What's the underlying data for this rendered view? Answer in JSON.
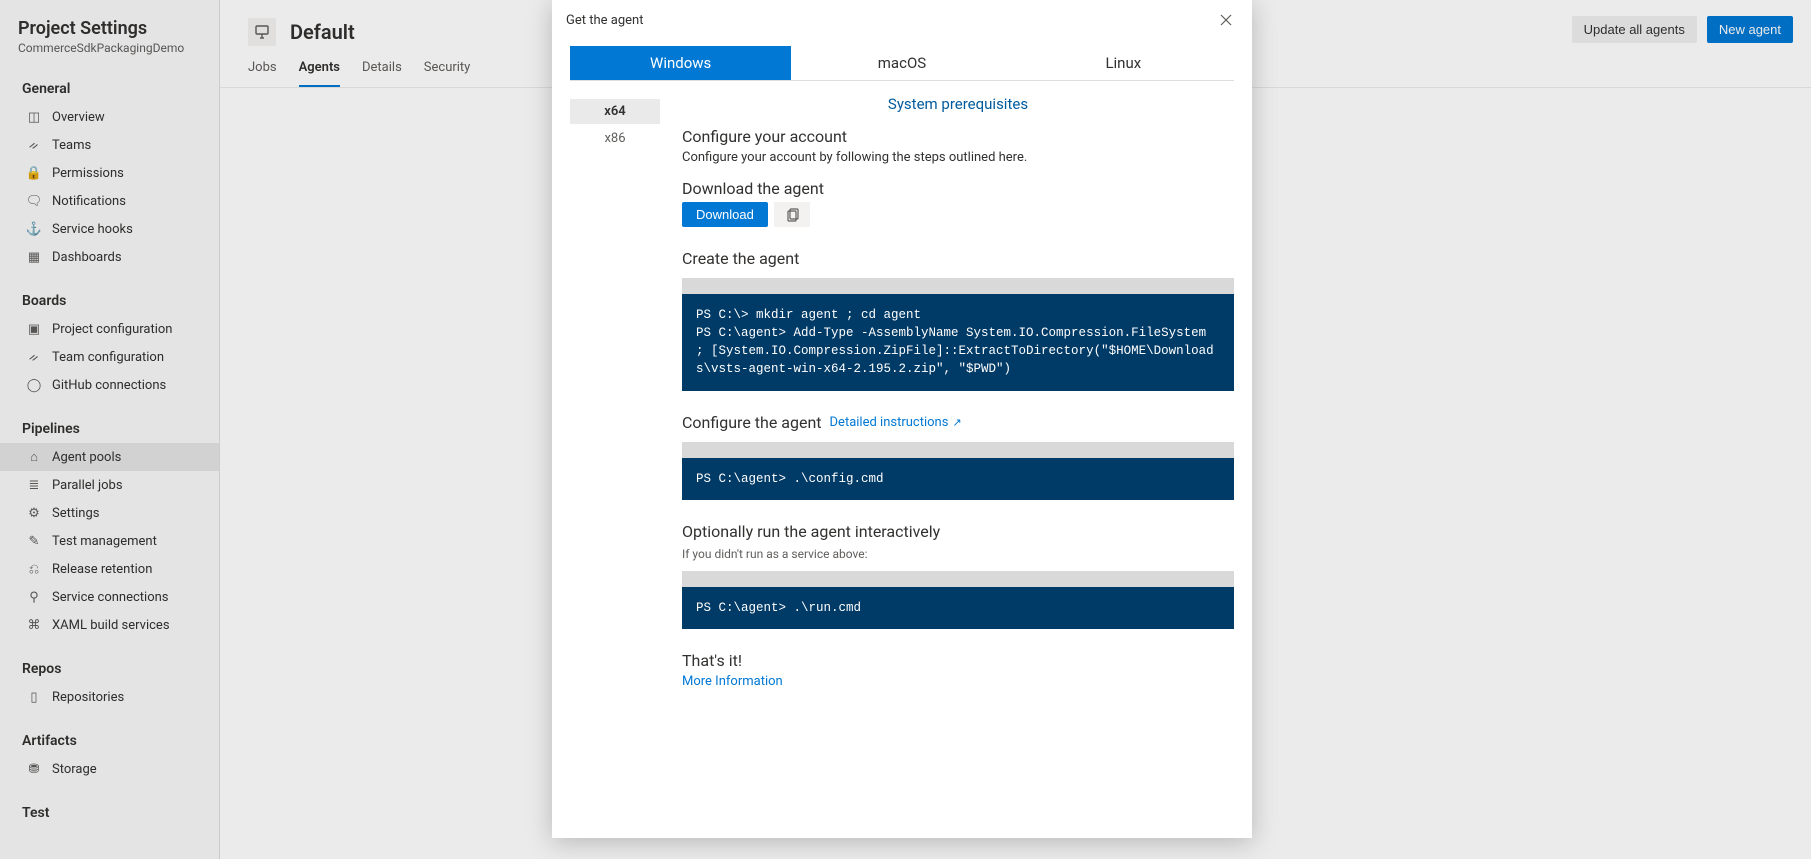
{
  "sidebar": {
    "title": "Project Settings",
    "subtitle": "CommerceSdkPackagingDemo",
    "groups": [
      {
        "label": "General",
        "items": [
          {
            "icon": "◫",
            "label": "Overview"
          },
          {
            "icon": "ᨀ",
            "label": "Teams"
          },
          {
            "icon": "🔒",
            "label": "Permissions"
          },
          {
            "icon": "🗨",
            "label": "Notifications"
          },
          {
            "icon": "⚓",
            "label": "Service hooks"
          },
          {
            "icon": "▦",
            "label": "Dashboards"
          }
        ]
      },
      {
        "label": "Boards",
        "items": [
          {
            "icon": "▣",
            "label": "Project configuration"
          },
          {
            "icon": "ᨀ",
            "label": "Team configuration"
          },
          {
            "icon": "◯",
            "label": "GitHub connections"
          }
        ]
      },
      {
        "label": "Pipelines",
        "items": [
          {
            "icon": "⌂",
            "label": "Agent pools",
            "selected": true
          },
          {
            "icon": "≣",
            "label": "Parallel jobs"
          },
          {
            "icon": "⚙",
            "label": "Settings"
          },
          {
            "icon": "✎",
            "label": "Test management"
          },
          {
            "icon": "⎌",
            "label": "Release retention"
          },
          {
            "icon": "⚲",
            "label": "Service connections"
          },
          {
            "icon": "⌘",
            "label": "XAML build services"
          }
        ]
      },
      {
        "label": "Repos",
        "items": [
          {
            "icon": "▯",
            "label": "Repositories"
          }
        ]
      },
      {
        "label": "Artifacts",
        "items": [
          {
            "icon": "⛃",
            "label": "Storage"
          }
        ]
      },
      {
        "label": "Test",
        "items": []
      }
    ]
  },
  "pool": {
    "name": "Default",
    "tabs": [
      "Jobs",
      "Agents",
      "Details",
      "Security"
    ],
    "active_tab": "Agents",
    "update_btn": "Update all agents",
    "new_btn": "New agent"
  },
  "dialog": {
    "title": "Get the agent",
    "os_tabs": [
      "Windows",
      "macOS",
      "Linux"
    ],
    "os_active": "Windows",
    "arch": [
      "x64",
      "x86"
    ],
    "arch_active": "x64",
    "prereq_link": "System prerequisites",
    "s1_h": "Configure your account",
    "s1_t": "Configure your account by following the steps outlined here.",
    "s2_h": "Download the agent",
    "download_btn": "Download",
    "s3_h": "Create the agent",
    "code1": "PS C:\\> mkdir agent ; cd agent\nPS C:\\agent> Add-Type -AssemblyName System.IO.Compression.FileSystem ; [System.IO.Compression.ZipFile]::ExtractToDirectory(\"$HOME\\Downloads\\vsts-agent-win-x64-2.195.2.zip\", \"$PWD\")",
    "s4_h": "Configure the agent",
    "s4_link": "Detailed instructions",
    "code2": "PS C:\\agent> .\\config.cmd",
    "s5_h": "Optionally run the agent interactively",
    "s5_note": "If you didn't run as a service above:",
    "code3": "PS C:\\agent> .\\run.cmd",
    "s6_h": "That's it!",
    "s6_link": "More Information"
  }
}
